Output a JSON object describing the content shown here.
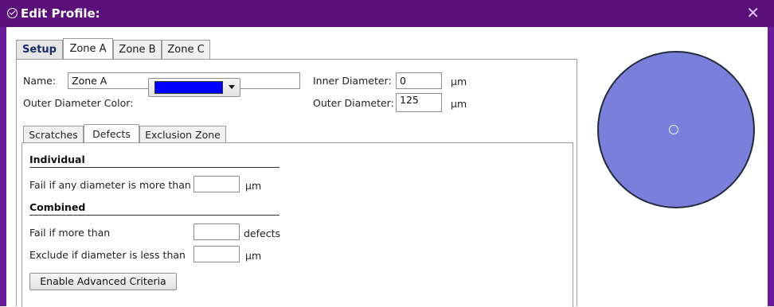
{
  "window": {
    "title": "Edit Profile:",
    "close_glyph": "✕"
  },
  "top_tabs": [
    {
      "label": "Setup"
    },
    {
      "label": "Zone A"
    },
    {
      "label": "Zone B"
    },
    {
      "label": "Zone C"
    }
  ],
  "zone": {
    "name_label": "Name:",
    "name_value": "Zone A",
    "inner_diameter_label": "Inner Diameter:",
    "inner_diameter_value": "0",
    "inner_unit": "μm",
    "outer_color_label": "Outer Diameter Color:",
    "outer_color": "#0000ff",
    "outer_diameter_label": "Outer Diameter:",
    "outer_diameter_value": "125",
    "outer_unit": "μm"
  },
  "inner_tabs": [
    {
      "label": "Scratches"
    },
    {
      "label": "Defects"
    },
    {
      "label": "Exclusion Zone"
    }
  ],
  "defects": {
    "individual_title": "Individual",
    "fail_diameter_label": "Fail if any diameter is more than",
    "fail_diameter_value": "",
    "fail_diameter_unit": "μm",
    "combined_title": "Combined",
    "fail_more_label": "Fail if more than",
    "fail_more_value": "",
    "fail_more_unit": "defects",
    "exclude_label": "Exclude if diameter is less than",
    "exclude_value": "",
    "exclude_unit": "μm",
    "advanced_button": "Enable Advanced Criteria"
  },
  "preview": {
    "disk_color": "#7b7fdb"
  }
}
